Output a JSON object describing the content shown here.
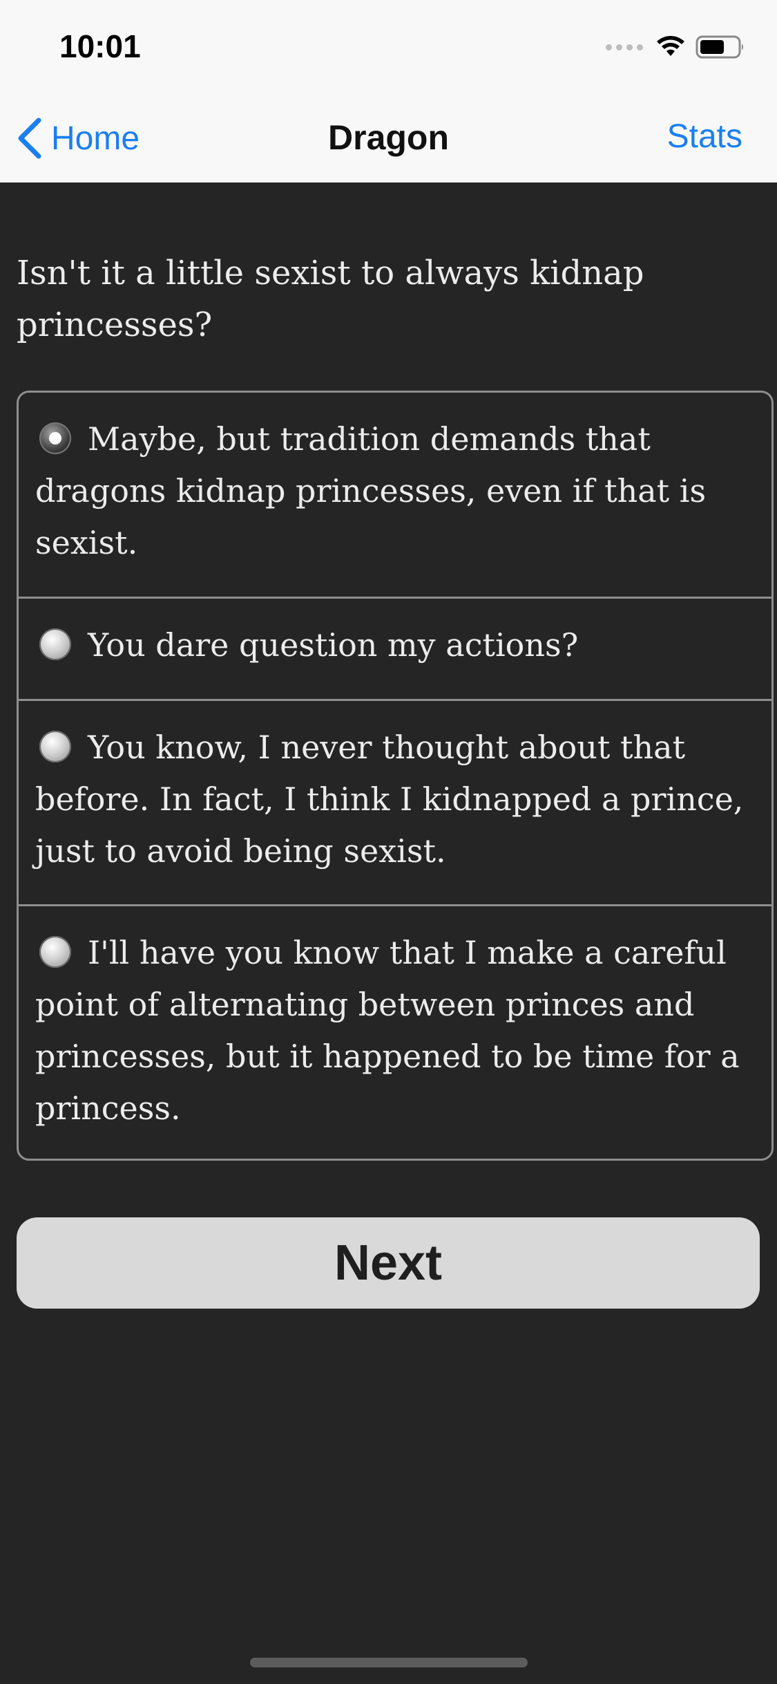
{
  "status_bar": {
    "time": "10:01"
  },
  "nav": {
    "back_label": "Home",
    "title": "Dragon",
    "right_label": "Stats"
  },
  "question": "Isn't it a little sexist to always kidnap princesses?",
  "options": [
    {
      "text": "Maybe, but tradition demands that dragons kidnap princesses, even if that is sexist.",
      "selected": true
    },
    {
      "text": "You dare question my actions?",
      "selected": false
    },
    {
      "text": "You know, I never thought about that before. In fact, I think I kidnapped a prince, just to avoid being sexist.",
      "selected": false
    },
    {
      "text": "I'll have you know that I make a careful point of alternating between princes and princesses, but it happened to be time for a princess.",
      "selected": false
    }
  ],
  "next_button": {
    "label": "Next"
  },
  "colors": {
    "accent": "#1a7ff0",
    "background": "#252525",
    "nav_background": "#f8f8f8",
    "button_background": "#d9d9d9"
  },
  "icons": [
    "signal-dots-icon",
    "wifi-icon",
    "battery-icon",
    "chevron-left-icon",
    "radio-selected-icon",
    "radio-unselected-icon"
  ]
}
